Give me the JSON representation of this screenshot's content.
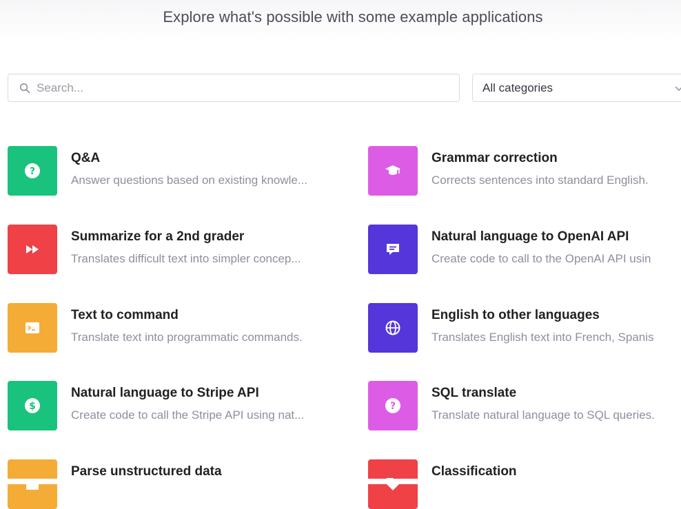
{
  "heading": "Explore what's possible with some example applications",
  "search": {
    "placeholder": "Search..."
  },
  "category_select": {
    "selected": "All categories"
  },
  "examples": [
    {
      "title": "Q&A",
      "description": "Answer questions based on existing knowle...",
      "color": "#19c37d",
      "icon": "question-icon"
    },
    {
      "title": "Grammar correction",
      "description": "Corrects sentences into standard English.",
      "color": "#dd5ce5",
      "icon": "graduation-cap-icon"
    },
    {
      "title": "Summarize for a 2nd grader",
      "description": "Translates difficult text into simpler concep...",
      "color": "#ef4146",
      "icon": "fast-forward-icon"
    },
    {
      "title": "Natural language to OpenAI API",
      "description": "Create code to call to the OpenAI API usin",
      "color": "#5436da",
      "icon": "message-icon"
    },
    {
      "title": "Text to command",
      "description": "Translate text into programmatic commands.",
      "color": "#f4ac36",
      "icon": "terminal-icon"
    },
    {
      "title": "English to other languages",
      "description": "Translates English text into French, Spanis",
      "color": "#5436da",
      "icon": "globe-icon"
    },
    {
      "title": "Natural language to Stripe API",
      "description": "Create code to call the Stripe API using nat...",
      "color": "#19c37d",
      "icon": "dollar-icon"
    },
    {
      "title": "SQL translate",
      "description": "Translate natural language to SQL queries.",
      "color": "#dd5ce5",
      "icon": "question-icon"
    },
    {
      "title": "Parse unstructured data",
      "description": "",
      "color": "#f4ac36",
      "icon": "table-icon"
    },
    {
      "title": "Classification",
      "description": "",
      "color": "#ef4146",
      "icon": "tag-icon"
    }
  ]
}
